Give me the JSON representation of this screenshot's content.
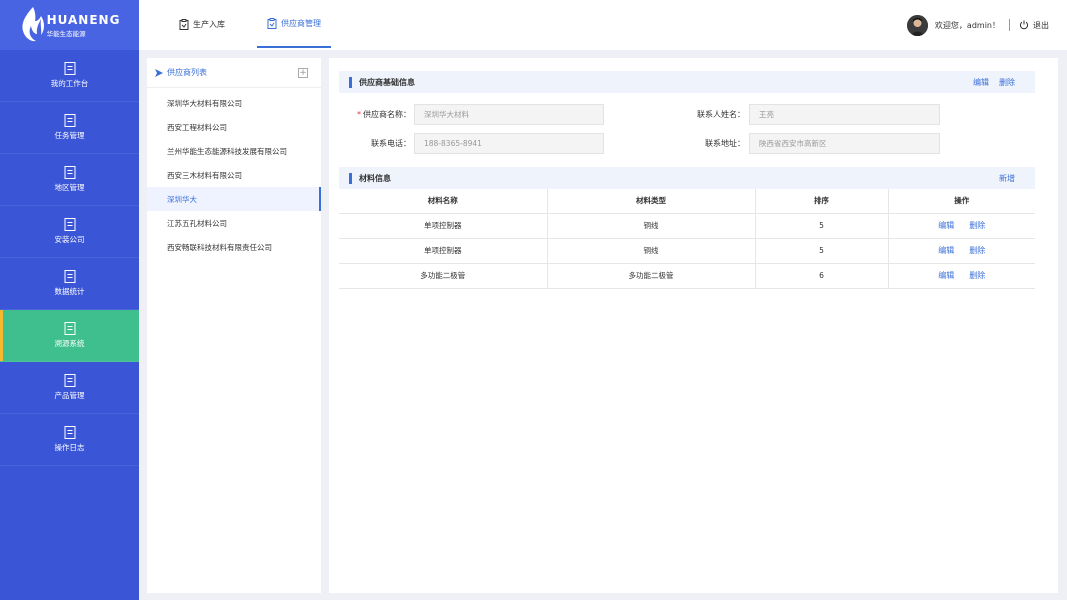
{
  "brand": {
    "name_en": "HUANENG",
    "name_cn": "华能生态能源",
    "color": "#3a55d6"
  },
  "nav": [
    {
      "label": "我的工作台",
      "icon": "document-icon"
    },
    {
      "label": "任务管理",
      "icon": "document-icon"
    },
    {
      "label": "地区管理",
      "icon": "document-icon"
    },
    {
      "label": "安装公司",
      "icon": "document-icon"
    },
    {
      "label": "数据统计",
      "icon": "document-icon"
    },
    {
      "label": "溯源系统",
      "icon": "document-icon",
      "active": true
    },
    {
      "label": "产品管理",
      "icon": "document-icon"
    },
    {
      "label": "操作日志",
      "icon": "document-icon"
    }
  ],
  "tabs": [
    {
      "label": "生产入库"
    },
    {
      "label": "供应商管理",
      "active": true
    }
  ],
  "user": {
    "greeting": "欢迎您，admin！",
    "logout": "退出"
  },
  "supplier_list": {
    "title": "供应商列表",
    "add_symbol": "+",
    "items": [
      "深圳华大材料有限公司",
      "西安工程材料公司",
      "兰州华能生态能源科技发展有限公司",
      "西安三木材料有限公司",
      "深圳华大",
      "江苏五孔材料公司",
      "西安畅联科技材料有限责任公司"
    ],
    "active_index": 4
  },
  "basic_info": {
    "title": "供应商基础信息",
    "edit": "编辑",
    "delete": "删除",
    "required_mark": "*",
    "fields": {
      "supplier_name": {
        "label": "供应商名称：",
        "value": "深圳华大材料"
      },
      "contact_name": {
        "label": "联系人姓名：",
        "value": "王亮"
      },
      "phone": {
        "label": "联系电话：",
        "value": "188-8365-8941"
      },
      "address": {
        "label": "联系地址：",
        "value": "陕西省西安市高新区"
      }
    }
  },
  "material_info": {
    "title": "材料信息",
    "add": "新增",
    "columns": [
      "材料名称",
      "材料类型",
      "排序",
      "操作"
    ],
    "rows": [
      {
        "name": "单项控制器",
        "type": "铜线",
        "order": "5"
      },
      {
        "name": "单项控制器",
        "type": "铜线",
        "order": "5"
      },
      {
        "name": "多功能二极管",
        "type": "多功能二极管",
        "order": "6"
      }
    ],
    "row_actions": {
      "edit": "编辑",
      "delete": "删除"
    }
  },
  "colors": {
    "accent": "#3a6fd8",
    "active_nav": "#3fbe8e",
    "active_marker": "#f5b82e"
  }
}
